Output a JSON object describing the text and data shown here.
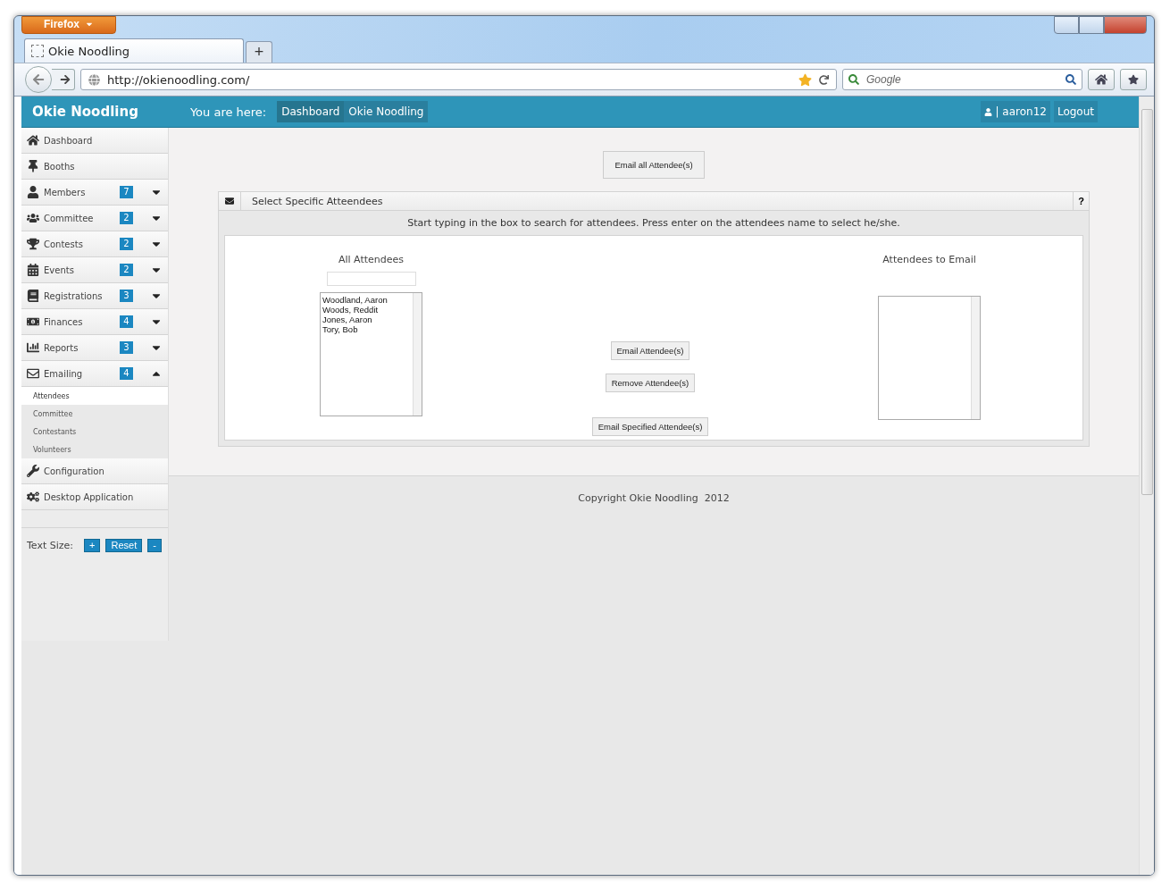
{
  "browser": {
    "menu_button": "Firefox",
    "tab": {
      "title": "Okie Noodling",
      "selected": true
    },
    "new_tab": "+",
    "url": "http://okienoodling.com/",
    "search_placeholder": "Google"
  },
  "header": {
    "brand": "Okie Noodling",
    "breadcrumb_label": "You are here:",
    "breadcrumbs": [
      "Dashboard",
      "Okie Noodling"
    ],
    "user": "| aaron12",
    "logout": "Logout"
  },
  "sidebar": {
    "items": [
      {
        "label": "Dashboard"
      },
      {
        "label": "Booths"
      },
      {
        "label": "Members",
        "badge": "7",
        "expanded": false
      },
      {
        "label": "Committee",
        "badge": "2",
        "expanded": false
      },
      {
        "label": "Contests",
        "badge": "2",
        "expanded": false
      },
      {
        "label": "Events",
        "badge": "2",
        "expanded": false
      },
      {
        "label": "Registrations",
        "badge": "3",
        "expanded": false
      },
      {
        "label": "Finances",
        "badge": "4",
        "expanded": false
      },
      {
        "label": "Reports",
        "badge": "3",
        "expanded": false
      },
      {
        "label": "Emailing",
        "badge": "4",
        "expanded": true,
        "children": [
          {
            "label": "Attendees",
            "selected": true
          },
          {
            "label": "Committee",
            "selected": false
          },
          {
            "label": "Contestants",
            "selected": false
          },
          {
            "label": "Volunteers",
            "selected": false
          }
        ]
      },
      {
        "label": "Configuration"
      },
      {
        "label": "Desktop Application"
      }
    ],
    "text_size": {
      "label": "Text Size:",
      "buttons": [
        "+",
        "Reset",
        "-"
      ]
    }
  },
  "main": {
    "email_all_button": "Email all Attendee(s)",
    "panel": {
      "title": "Select Specific Atteendees",
      "help": "?",
      "instructions": "Start typing in the box to search for attendees. Press enter on the attendees name to select he/she.",
      "all_attendees": {
        "title": "All Attendees",
        "items": [
          "Woodland, Aaron",
          "Woods, Reddit",
          "Jones, Aaron",
          "Tory, Bob"
        ]
      },
      "email_button": "Email Attendee(s)",
      "remove_button": "Remove Attendee(s)",
      "send_button": "Email Specified Attendee(s)",
      "to_email": {
        "title": "Attendees to Email"
      }
    }
  },
  "footer": {
    "copyright": "Copyright Okie Noodling  2012"
  }
}
